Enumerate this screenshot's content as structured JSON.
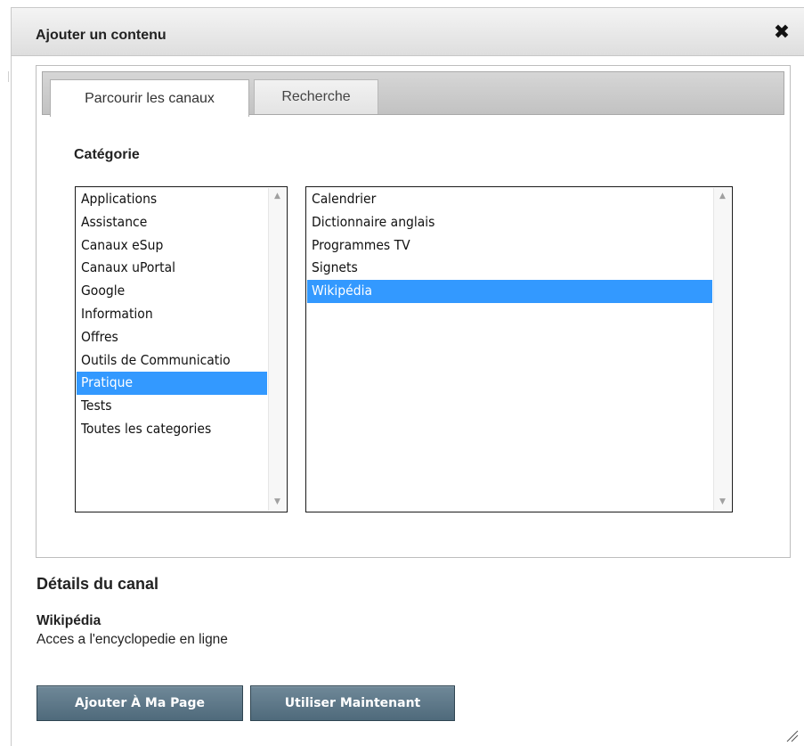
{
  "dialog": {
    "title": "Ajouter un contenu",
    "close_icon": "close-icon"
  },
  "tabs": [
    {
      "label": "Parcourir les canaux",
      "active": true
    },
    {
      "label": "Recherche",
      "active": false
    }
  ],
  "browse": {
    "category_label": "Catégorie",
    "categories": [
      "Applications",
      "Assistance",
      "Canaux eSup",
      "Canaux uPortal",
      "Google",
      "Information",
      "Offres",
      "Outils de Communicatio",
      "Pratique",
      "Tests",
      "Toutes les categories"
    ],
    "selected_category": "Pratique",
    "channels": [
      "Calendrier",
      "Dictionnaire anglais",
      "Programmes TV",
      "Signets",
      "Wikipédia"
    ],
    "selected_channel": "Wikipédia"
  },
  "details": {
    "heading": "Détails du canal",
    "channel_name": "Wikipédia",
    "channel_description": "Acces a l'encyclopedie en ligne"
  },
  "actions": {
    "add_label": "Ajouter À Ma Page",
    "use_label": "Utiliser Maintenant"
  },
  "colors": {
    "selection": "#3399ff",
    "button": "#5a7586"
  }
}
